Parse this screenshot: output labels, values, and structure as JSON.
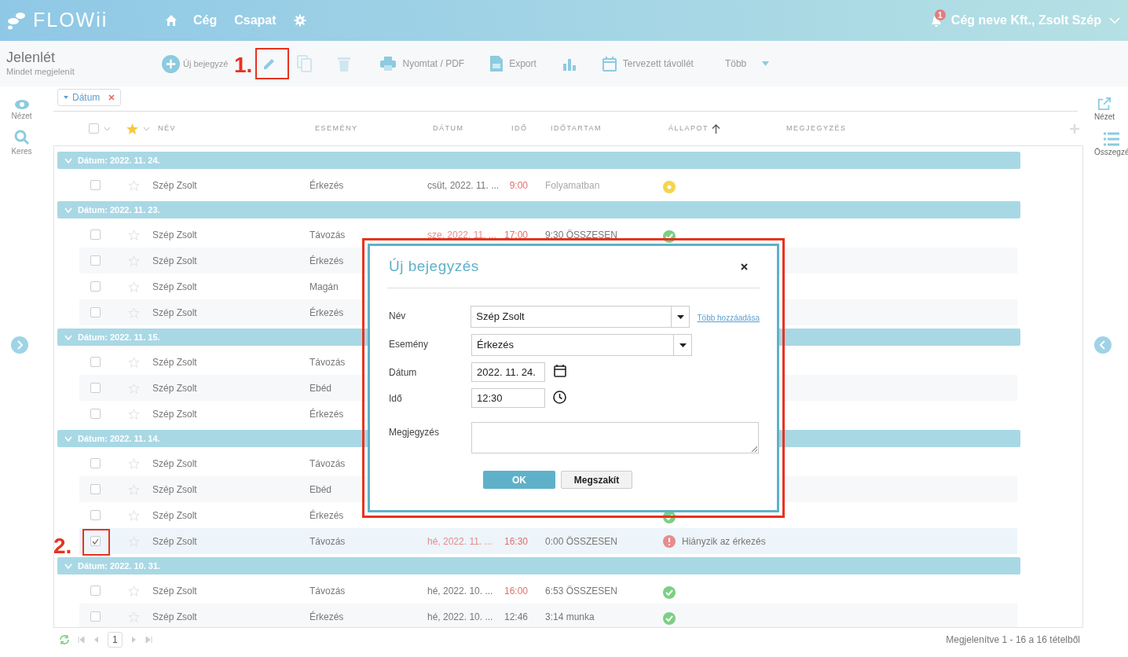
{
  "top_bar": {
    "logo": "FLOWii",
    "nav": [
      "Cég",
      "Csapat"
    ],
    "notifications": "1",
    "account": "Cég neve Kft., Zsolt Szép"
  },
  "toolbar": {
    "title": "Jelenlét",
    "subtitle": "Mindet megjelenít",
    "new_entry": "Új bejegyzé",
    "print": "Nyomtat / PDF",
    "export": "Export",
    "planned_absence": "Tervezett távollét",
    "more": "Több"
  },
  "left_sidebar": [
    {
      "kind": "view",
      "label": "Nézet"
    },
    {
      "kind": "search",
      "label": "Keres"
    }
  ],
  "right_sidebar": [
    {
      "kind": "open",
      "label": "Nézet"
    },
    {
      "kind": "summary",
      "label": "Összegzé"
    }
  ],
  "filter_chip": "Dátum",
  "table": {
    "all_checked": false,
    "columns": [
      "NÉV",
      "ESEMÉNY",
      "DÁTUM",
      "IDŐ",
      "IDŐTARTAM",
      "ÁLLAPOT",
      "MEGJEGYZÉS"
    ],
    "groups": [
      {
        "label": "Dátum: 2022. 11. 24.",
        "rows": [
          {
            "selected": false,
            "name": "Szép Zsolt",
            "event": "Érkezés",
            "date": "csüt, 2022. 11. ...",
            "date_alert": false,
            "time": "9:00",
            "time_alert": true,
            "duration": "Folyamatban",
            "status": {
              "kind": "in_progress"
            }
          }
        ]
      },
      {
        "label": "Dátum: 2022. 11. 23.",
        "rows": [
          {
            "selected": false,
            "name": "Szép Zsolt",
            "event": "Távozás",
            "date": "sze, 2022. 11. ...",
            "date_alert": true,
            "time": "17:00",
            "time_alert": true,
            "duration": "9:30 ÖSSZESEN",
            "status": {
              "kind": "ok"
            }
          },
          {
            "selected": false,
            "name": "Szép Zsolt",
            "event": "Érkezés"
          },
          {
            "selected": false,
            "name": "Szép Zsolt",
            "event": "Magán"
          },
          {
            "selected": false,
            "name": "Szép Zsolt",
            "event": "Érkezés"
          }
        ]
      },
      {
        "label": "Dátum: 2022. 11. 15.",
        "rows": [
          {
            "selected": false,
            "name": "Szép Zsolt",
            "event": "Távozás"
          },
          {
            "selected": false,
            "name": "Szép Zsolt",
            "event": "Ebéd"
          },
          {
            "selected": false,
            "name": "Szép Zsolt",
            "event": "Érkezés"
          }
        ]
      },
      {
        "label": "Dátum: 2022. 11. 14.",
        "rows": [
          {
            "selected": false,
            "name": "Szép Zsolt",
            "event": "Távozás"
          },
          {
            "selected": false,
            "name": "Szép Zsolt",
            "event": "Ebéd"
          },
          {
            "selected": false,
            "name": "Szép Zsolt",
            "event": "Érkezés",
            "status": {
              "kind": "ok"
            }
          },
          {
            "selected": true,
            "name": "Szép Zsolt",
            "event": "Távozás",
            "date": "hé, 2022. 11. ...",
            "date_alert": true,
            "time": "16:30",
            "time_alert": true,
            "duration": "0:00 ÖSSZESEN",
            "status": {
              "kind": "error",
              "text": "Hiányzik az érkezés"
            }
          }
        ]
      },
      {
        "label": "Dátum: 2022. 10. 31.",
        "rows": [
          {
            "selected": false,
            "name": "Szép Zsolt",
            "event": "Távozás",
            "date": "hé, 2022. 10. ...",
            "date_alert": false,
            "time": "16:00",
            "time_alert": true,
            "duration": "6:53 ÖSSZESEN",
            "status": {
              "kind": "ok"
            }
          },
          {
            "selected": false,
            "name": "Szép Zsolt",
            "event": "Érkezés",
            "date": "hé, 2022. 10. ...",
            "date_alert": false,
            "time": "12:46",
            "time_alert": false,
            "duration": "3:14 munka",
            "status": {
              "kind": "ok"
            }
          }
        ]
      }
    ]
  },
  "pager": {
    "page": "1",
    "summary": "Megjelenítve 1 - 16 a 16 tételből"
  },
  "dialog": {
    "title": "Új bejegyzés",
    "fields": [
      {
        "kind": "select",
        "label": "Név",
        "value": "Szép Zsolt",
        "link": "Több hozzáadása"
      },
      {
        "kind": "select",
        "label": "Esemény",
        "value": "Érkezés"
      },
      {
        "kind": "date",
        "label": "Dátum",
        "value": "2022. 11. 24."
      },
      {
        "kind": "time",
        "label": "Idő",
        "value": "12:30"
      },
      {
        "kind": "textarea",
        "label": "Megjegyzés"
      }
    ],
    "buttons": [
      "OK",
      "Megszakít"
    ]
  },
  "annotations": [
    "1.",
    "2."
  ]
}
